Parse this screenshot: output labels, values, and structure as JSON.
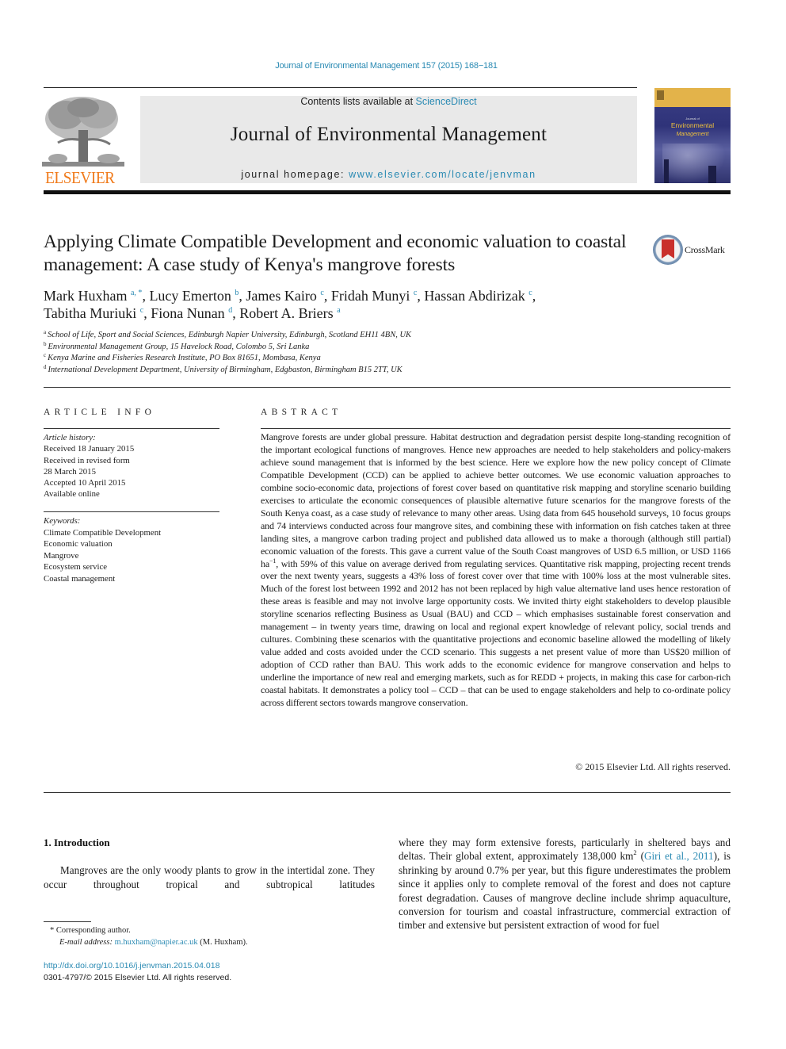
{
  "journal_ref": "Journal of Environmental Management 157 (2015) 168−181",
  "masthead": {
    "contents_prefix": "Contents lists available at ",
    "contents_link": "ScienceDirect",
    "journal_title": "Journal of Environmental Management",
    "homepage_prefix": "journal homepage: ",
    "homepage_link": "www.elsevier.com/locate/jenvman",
    "publisher": "ELSEVIER",
    "cover": {
      "small": "Journal of",
      "title": "Environmental",
      "subtitle": "Management"
    }
  },
  "crossmark_label": "CrossMark",
  "article": {
    "title": "Applying Climate Compatible Development and economic valuation to coastal management: A case study of Kenya's mangrove forests",
    "authors": [
      {
        "name": "Mark Huxham",
        "aff": "a, *",
        "sep": ", "
      },
      {
        "name": "Lucy Emerton",
        "aff": "b",
        "sep": ", "
      },
      {
        "name": "James Kairo",
        "aff": "c",
        "sep": ", "
      },
      {
        "name": "Fridah Munyi",
        "aff": "c",
        "sep": ", "
      },
      {
        "name": "Hassan Abdirizak",
        "aff": "c",
        "sep": ","
      },
      {
        "name": "Tabitha Muriuki",
        "aff": "c",
        "sep": ", "
      },
      {
        "name": "Fiona Nunan",
        "aff": "d",
        "sep": ", "
      },
      {
        "name": "Robert A. Briers",
        "aff": "a",
        "sep": ""
      }
    ],
    "affiliations": [
      {
        "key": "a",
        "text": "School of Life, Sport and Social Sciences, Edinburgh Napier University, Edinburgh, Scotland EH11 4BN, UK"
      },
      {
        "key": "b",
        "text": "Environmental Management Group, 15 Havelock Road, Colombo 5, Sri Lanka"
      },
      {
        "key": "c",
        "text": "Kenya Marine and Fisheries Research Institute, PO Box 81651, Mombasa, Kenya"
      },
      {
        "key": "d",
        "text": "International Development Department, University of Birmingham, Edgbaston, Birmingham B15 2TT, UK"
      }
    ]
  },
  "article_info": {
    "heading": "ARTICLE INFO",
    "history_label": "Article history:",
    "history": [
      "Received 18 January 2015",
      "Received in revised form",
      "28 March 2015",
      "Accepted 10 April 2015",
      "Available online"
    ],
    "keywords_label": "Keywords:",
    "keywords": [
      "Climate Compatible Development",
      "Economic valuation",
      "Mangrove",
      "Ecosystem service",
      "Coastal management"
    ]
  },
  "abstract": {
    "heading": "ABSTRACT",
    "text_before_sup": "Mangrove forests are under global pressure. Habitat destruction and degradation persist despite long-standing recognition of the important ecological functions of mangroves. Hence new approaches are needed to help stakeholders and policy-makers achieve sound management that is informed by the best science. Here we explore how the new policy concept of Climate Compatible Development (CCD) can be applied to achieve better outcomes. We use economic valuation approaches to combine socio-economic data, projections of forest cover based on quantitative risk mapping and storyline scenario building exercises to articulate the economic consequences of plausible alternative future scenarios for the mangrove forests of the South Kenya coast, as a case study of relevance to many other areas. Using data from 645 household surveys, 10 focus groups and 74 interviews conducted across four mangrove sites, and combining these with information on fish catches taken at three landing sites, a mangrove carbon trading project and published data allowed us to make a thorough (although still partial) economic valuation of the forests. This gave a current value of the South Coast mangroves of USD 6.5 million, or USD 1166 ha",
    "sup": "−1",
    "text_after_sup": ", with 59% of this value on average derived from regulating services. Quantitative risk mapping, projecting recent trends over the next twenty years, suggests a 43% loss of forest cover over that time with 100% loss at the most vulnerable sites. Much of the forest lost between 1992 and 2012 has not been replaced by high value alternative land uses hence restoration of these areas is feasible and may not involve large opportunity costs. We invited thirty eight stakeholders to develop plausible storyline scenarios reflecting Business as Usual (BAU) and CCD – which emphasises sustainable forest conservation and management – in twenty years time, drawing on local and regional expert knowledge of relevant policy, social trends and cultures. Combining these scenarios with the quantitative projections and economic baseline allowed the modelling of likely value added and costs avoided under the CCD scenario. This suggests a net present value of more than US$20 million of adoption of CCD rather than BAU. This work adds to the economic evidence for mangrove conservation and helps to underline the importance of new real and emerging markets, such as for REDD + projects, in making this case for carbon-rich coastal habitats. It demonstrates a policy tool – CCD – that can be used to engage stakeholders and help to co-ordinate policy across different sectors towards mangrove conservation.",
    "copyright": "© 2015 Elsevier Ltd. All rights reserved."
  },
  "introduction": {
    "heading": "1.  Introduction",
    "left_text": "Mangroves are the only woody plants to grow in the intertidal zone. They occur throughout tropical and subtropical latitudes",
    "right_part1": "where they may form extensive forests, particularly in sheltered bays and deltas. Their global extent, approximately 138,000 km",
    "right_sup": "2",
    "right_cite_open": " (",
    "right_cite": "Giri et al., 2011",
    "right_part2": "), is shrinking by around 0.7% per year, but this figure underestimates the problem since it applies only to complete removal of the forest and does not capture forest degradation. Causes of mangrove decline include shrimp aquaculture, conversion for tourism and coastal infrastructure, commercial extraction of timber and extensive but persistent extraction of wood for fuel"
  },
  "footnotes": {
    "corresponding": "* Corresponding author.",
    "email_label": "E-mail address: ",
    "email": "m.huxham@napier.ac.uk",
    "email_suffix": " (M. Huxham).",
    "doi": "http://dx.doi.org/10.1016/j.jenvman.2015.04.018",
    "issn": "0301-4797/© 2015 Elsevier Ltd. All rights reserved."
  },
  "colors": {
    "link": "#2a8ab3",
    "elsevier_orange": "#f07a1a",
    "masthead_bg": "#e9e9e9",
    "crossmark_red": "#c9302c"
  }
}
